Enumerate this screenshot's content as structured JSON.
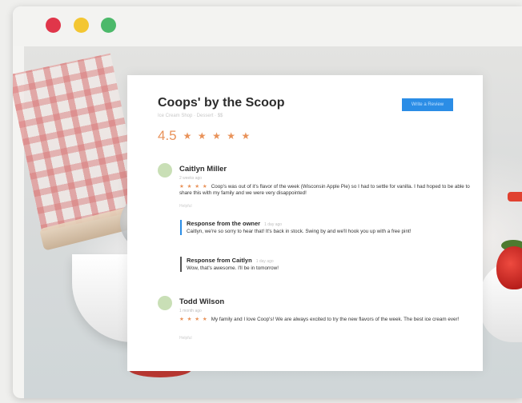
{
  "window": {
    "traffic_lights": [
      "close",
      "minimize",
      "zoom"
    ]
  },
  "business": {
    "name": "Coops' by the Scoop",
    "subtitle": "Ice Cream Shop · Dessert · $$",
    "write_review_label": "Write a Review",
    "rating": "4.5",
    "rating_value": 4.5,
    "stars": [
      "★",
      "★",
      "★",
      "★",
      "★"
    ]
  },
  "reviews": [
    {
      "name": "Caitlyn Miller",
      "date": "2 weeks ago",
      "stars": "★ ★ ★ ★",
      "body": "Coop's was out of it's flavor of the week (Wisconsin Apple Pie) so I had to settle for vanilla. I had hoped to be able to share this with my family and we were very disappointed!",
      "helpful": "Helpful"
    },
    {
      "name": "Todd Wilson",
      "date": "1 month ago",
      "stars": "★ ★ ★ ★",
      "body": "My family and I love Coop's! We are always excited to try the new flavors of the week. The best ice cream ever!",
      "helpful": "Helpful"
    }
  ],
  "responses": [
    {
      "title": "Response from the owner",
      "date": "1 day ago",
      "body": "Caitlyn, we're so sorry to hear that! It's back in stock. Swing by and we'll hook you up with a free pint!"
    },
    {
      "title": "Response from Caitlyn",
      "date": "1 day ago",
      "body": "Wow, that's awesome. I'll be in tomorrow!"
    }
  ],
  "colors": {
    "accent": "#2b8de6",
    "star": "#e99259",
    "avatar": "#c9dfb6"
  }
}
